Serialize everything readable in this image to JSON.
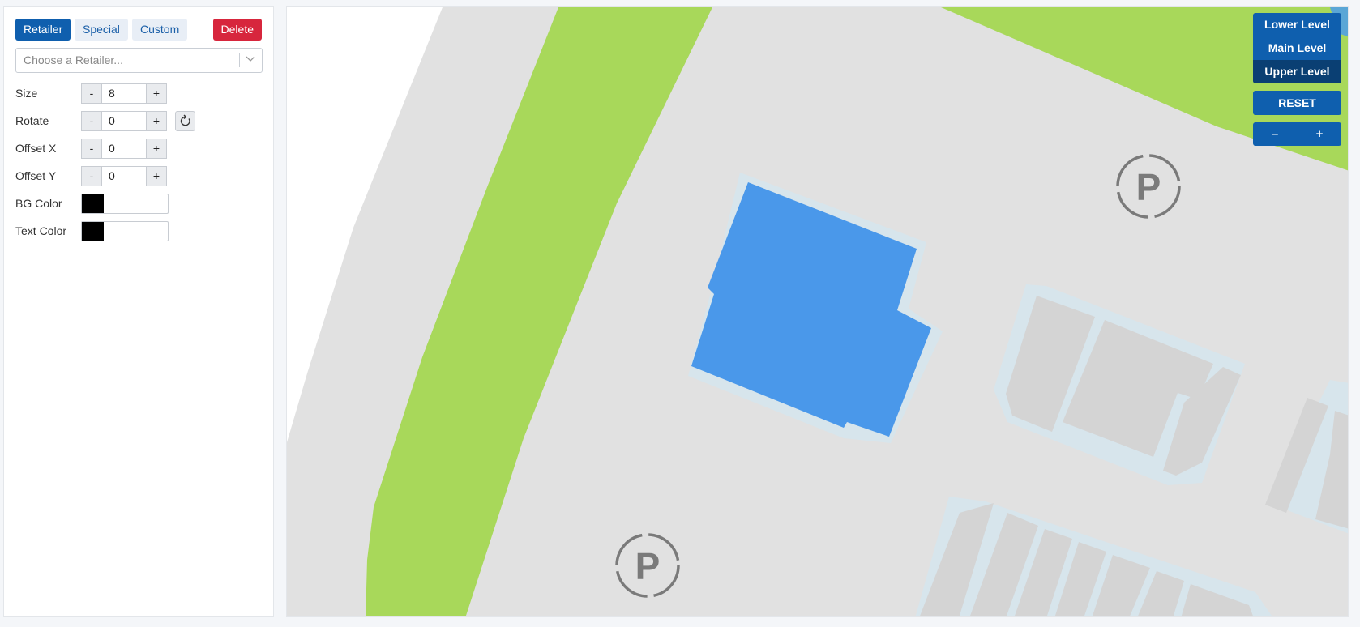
{
  "tabs": [
    {
      "label": "Retailer",
      "active": true
    },
    {
      "label": "Special",
      "active": false
    },
    {
      "label": "Custom",
      "active": false
    }
  ],
  "delete_label": "Delete",
  "retailer_select": {
    "placeholder": "Choose a Retailer..."
  },
  "controls": {
    "size": {
      "label": "Size",
      "value": "8",
      "minus": "-",
      "plus": "+"
    },
    "rotate": {
      "label": "Rotate",
      "value": "0",
      "minus": "-",
      "plus": "+"
    },
    "offset_x": {
      "label": "Offset X",
      "value": "0",
      "minus": "-",
      "plus": "+"
    },
    "offset_y": {
      "label": "Offset Y",
      "value": "0",
      "minus": "-",
      "plus": "+"
    }
  },
  "bg_color": {
    "label": "BG Color",
    "color": "#000000"
  },
  "text_color": {
    "label": "Text Color",
    "color": "#000000"
  },
  "levels": [
    {
      "label": "Lower Level",
      "active": false
    },
    {
      "label": "Main Level",
      "active": false
    },
    {
      "label": "Upper Level",
      "active": true
    }
  ],
  "reset_label": "RESET",
  "zoom": {
    "minus": "–",
    "plus": "+"
  },
  "map_colors": {
    "ground": "#e1e1e1",
    "green": "#a8d85a",
    "selected_store": "#4a98ea",
    "store": "#d4d4d4",
    "store_outline": "#d7e5ec",
    "parking_icon": "#7a7a7a"
  },
  "map": {
    "parking_symbol": "P"
  }
}
